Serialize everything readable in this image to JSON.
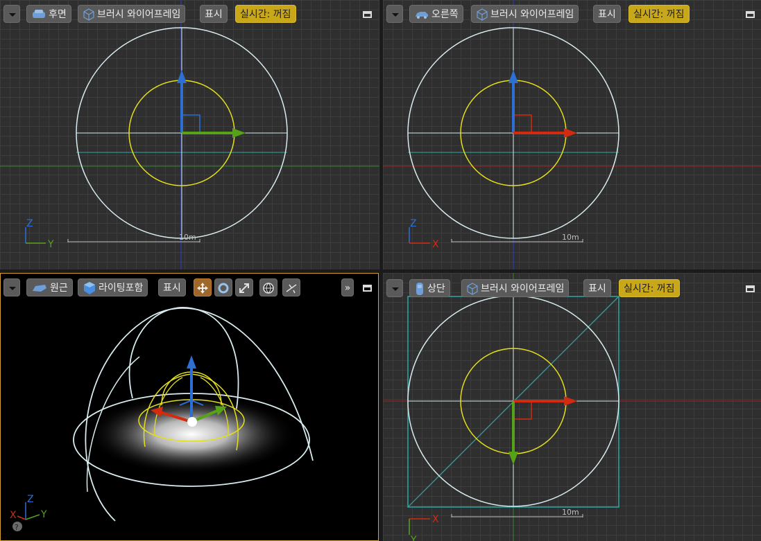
{
  "viewports": {
    "back": {
      "view_label": "후면",
      "mode_label": "브러시 와이어프레임",
      "show_label": "표시",
      "realtime_label": "실시간: 꺼짐",
      "scale_label": "10m",
      "axis_up": "Z",
      "axis_right": "Y"
    },
    "right": {
      "view_label": "오른쪽",
      "mode_label": "브러시 와이어프레임",
      "show_label": "표시",
      "realtime_label": "실시간: 꺼짐",
      "scale_label": "10m",
      "axis_up": "Z",
      "axis_right": "X"
    },
    "perspective": {
      "view_label": "원근",
      "mode_label": "라이팅포함",
      "show_label": "표시",
      "more_label": "»",
      "axis_up": "Z",
      "axis_left": "X",
      "axis_right": "Y",
      "help_label": "?"
    },
    "top": {
      "view_label": "상단",
      "mode_label": "브러시 와이어프레임",
      "show_label": "표시",
      "realtime_label": "실시간: 꺼짐",
      "scale_label": "10m",
      "axis_right": "X",
      "axis_down": "Y"
    }
  },
  "colors": {
    "realtime_bg": "#c8a81a",
    "radius_circle": "#d8ecf0",
    "cone_circle": "#e5e01a",
    "axis_x": "#d42a10",
    "axis_y": "#56a318",
    "axis_z": "#2d6fd2",
    "selected_border": "#d9a230"
  },
  "icons": {
    "view_menu": "dropdown-triangle-icon",
    "back_view": "car-back-icon",
    "right_view": "car-side-icon",
    "top_view": "car-top-icon",
    "wireframe": "wireframe-cube-icon",
    "perspective": "perspective-car-icon",
    "lit": "lit-cube-icon",
    "move": "move-icon",
    "rotate": "rotate-icon",
    "scale": "scale-icon",
    "world": "globe-icon",
    "snap": "snap-icon",
    "maximize": "maximize-icon"
  }
}
